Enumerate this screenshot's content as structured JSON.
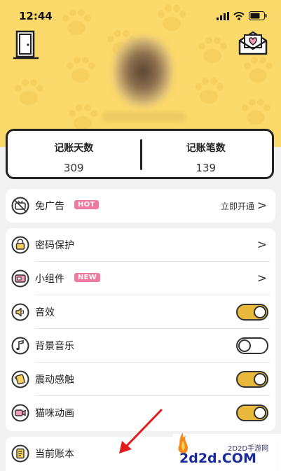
{
  "status_bar": {
    "time": "12:44"
  },
  "stats": {
    "days_label": "记账天数",
    "days_value": "309",
    "entries_label": "记账笔数",
    "entries_value": "139"
  },
  "ad_card": {
    "label": "免广告",
    "badge": "HOT",
    "action": "立即开通"
  },
  "settings": {
    "password": {
      "label": "密码保护"
    },
    "widget": {
      "label": "小组件",
      "badge": "NEW"
    },
    "sound": {
      "label": "音效",
      "enabled": true
    },
    "music": {
      "label": "背景音乐",
      "enabled": false
    },
    "vibration": {
      "label": "震动感触",
      "enabled": true
    },
    "cat_animation": {
      "label": "猫咪动画",
      "enabled": true
    }
  },
  "ledger": {
    "label": "当前账本"
  },
  "watermark": {
    "logo": "2d2d.COM",
    "site": "2D2D手游网"
  },
  "colors": {
    "header": "#fbd96a",
    "toggle_on": "#e8b93b",
    "badge": "#f07a9f"
  }
}
